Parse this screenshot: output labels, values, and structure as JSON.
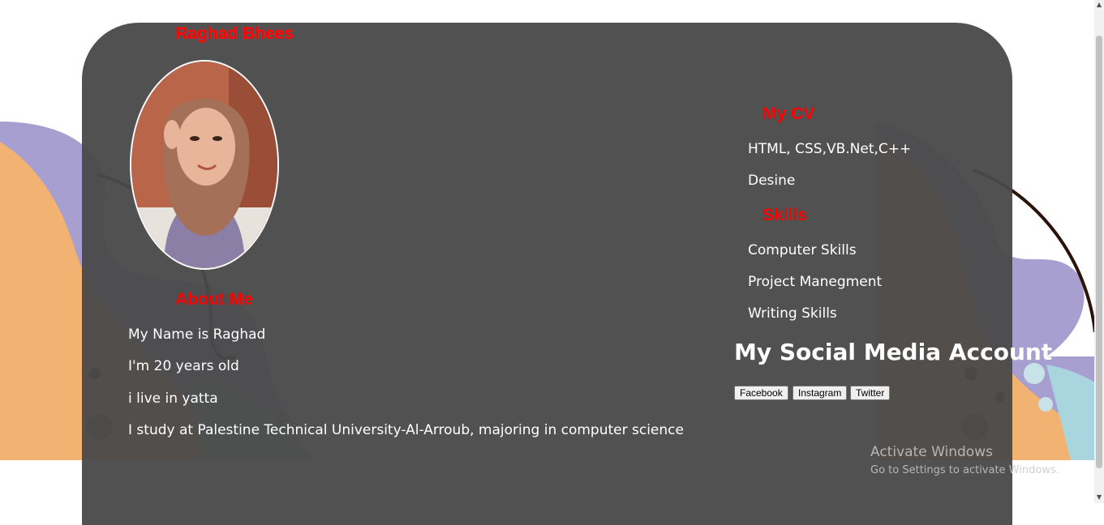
{
  "profile": {
    "name": "Raghad Bhees",
    "photo_alt": "profile photo"
  },
  "about": {
    "heading": "About Me",
    "lines": [
      "My Name is Raghad",
      "I'm 20 years old",
      "i live in yatta",
      "I study at Palestine Technical University-Al-Arroub, majoring in computer science"
    ]
  },
  "cv": {
    "heading": "My CV",
    "items": [
      "HTML, CSS,VB.Net,C++",
      "Desine"
    ]
  },
  "skills": {
    "heading": "Skills",
    "items": [
      "Computer Skills",
      "Project Manegment",
      "Writing Skills"
    ]
  },
  "social": {
    "heading": "My Social Media Account",
    "buttons": [
      "Facebook",
      "Instagram",
      "Twitter"
    ]
  },
  "watermark": {
    "title": "Activate Windows",
    "subtitle": "Go to Settings to activate Windows."
  },
  "colors": {
    "card": "#4a4a4a",
    "heading_red": "#ff0000",
    "text": "#ffffff",
    "blob_orange": "#f2b272",
    "blob_purple": "#a89fd1",
    "blob_teal": "#a9d6de"
  }
}
